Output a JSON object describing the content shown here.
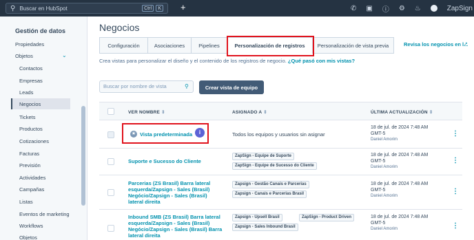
{
  "topbar": {
    "search_placeholder": "Buscar en HubSpot",
    "shortcut1": "Ctrl",
    "shortcut2": "K",
    "account_label": "ZapSign"
  },
  "sidebar": {
    "title": "Gestión de datos",
    "items": [
      {
        "label": "Propiedades"
      },
      {
        "label": "Objetos"
      },
      {
        "label": "Contactos"
      },
      {
        "label": "Empresas"
      },
      {
        "label": "Leads"
      },
      {
        "label": "Negocios"
      },
      {
        "label": "Tickets"
      },
      {
        "label": "Productos"
      },
      {
        "label": "Cotizaciones"
      },
      {
        "label": "Facturas"
      },
      {
        "label": "Previsión"
      },
      {
        "label": "Actividades"
      },
      {
        "label": "Campañas"
      },
      {
        "label": "Listas"
      },
      {
        "label": "Eventos de marketing"
      },
      {
        "label": "Workflows"
      },
      {
        "label": "Objetos"
      }
    ]
  },
  "main": {
    "title": "Negocios",
    "tabs": [
      {
        "label": "Configuración"
      },
      {
        "label": "Asociaciones"
      },
      {
        "label": "Pipelines"
      },
      {
        "label": "Personalización de registros"
      },
      {
        "label": "Personalización de vista previa"
      }
    ],
    "tab_link": "Revisa los negocios en l...",
    "description": "Crea vistas para personalizar el diseño y el contenido de los registros de negocio.",
    "description_link": "¿Qué pasó con mis vistas?",
    "search_placeholder": "Buscar por nombre de vista",
    "create_button": "Crear vista de equipo",
    "table": {
      "headers": {
        "name": "VER NOMBRE",
        "assigned": "ASIGNADO A",
        "updated": "ÚLTIMA ACTUALIZACIÓN"
      },
      "rows": [
        {
          "name": "Vista predeterminada",
          "assigned_text": "Todos los equipos y usuarios sin asignar",
          "updated": [
            "18 de jul. de 2024 7:48 AM",
            "GMT-5"
          ],
          "who": "Daniel Amorim"
        },
        {
          "name": "Suporte e Sucesso do Cliente",
          "tags": [
            "ZapSign - Equipe de Suporte",
            "ZapSign - Equipe de Sucesso do Cliente"
          ],
          "updated": [
            "18 de jul. de 2024 7:48 AM",
            "GMT-5"
          ],
          "who": "Daniel Amorim"
        },
        {
          "name_lines": [
            "Parcerias (ZS Brasil) Barra lateral",
            "esquerda/Zapsign - Sales (Brasil)",
            "Negócio/Zapsign - Sales (Brasil)",
            "lateral direita"
          ],
          "tags": [
            "Zapsign - Gestão Canais e Parcerias",
            "Zapsign - Canais e Parcerias Brasil"
          ],
          "updated": [
            "18 de jul. de 2024 7:48 AM",
            "GMT-5"
          ],
          "who": "Daniel Amorim"
        },
        {
          "name_lines": [
            "Inbound SMB (ZS Brasil) Barra lateral",
            "esquerda/Zapsign - Sales (Brasil)",
            "Negócio/Zapsign - Sales (Brasil) Barra",
            "lateral direita"
          ],
          "tags": [
            "Zapsign - Upsell Brasil",
            "ZapSign - Product Driven",
            "Zapsign - Sales Inbound Brasil"
          ],
          "updated": [
            "18 de jul. de 2024 7:48 AM",
            "GMT-5"
          ],
          "who": "Daniel Amorim"
        }
      ]
    }
  }
}
